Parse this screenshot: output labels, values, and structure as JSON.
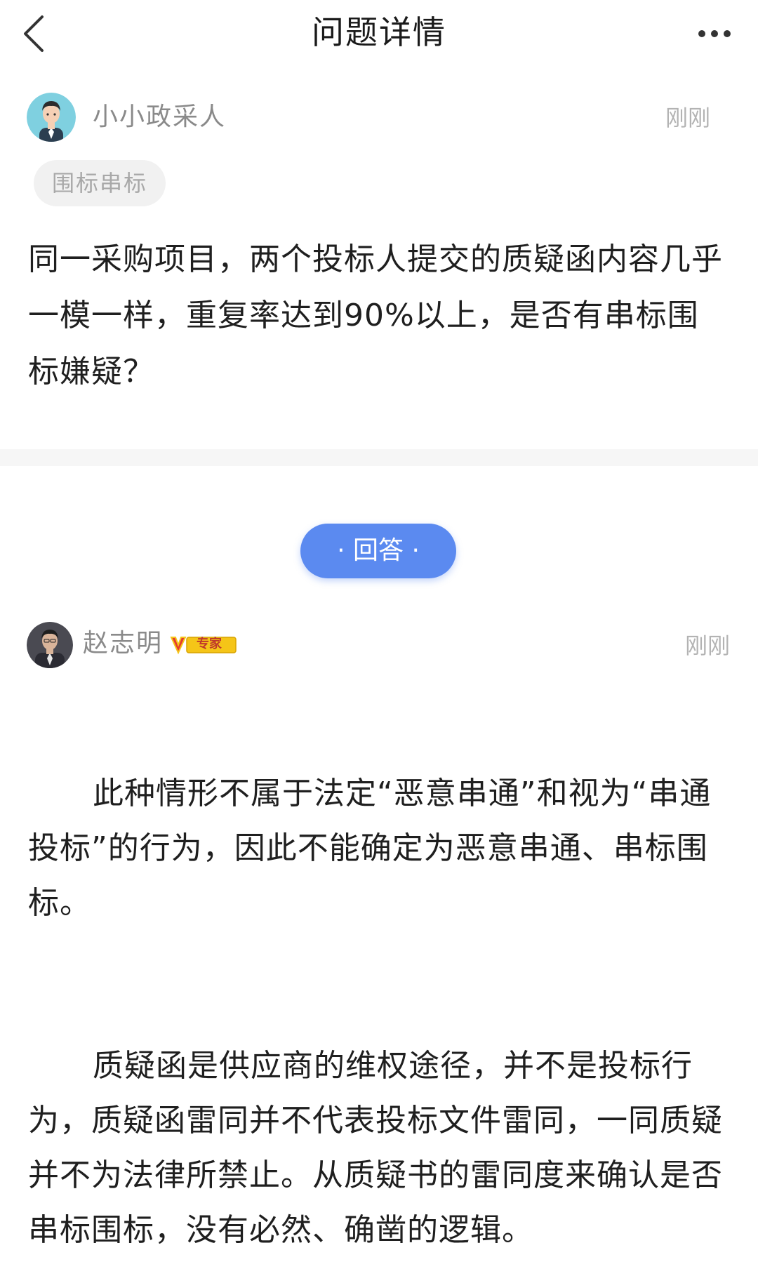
{
  "header": {
    "title": "问题详情",
    "back_icon": "chevron-left-icon",
    "more_icon": "more-horizontal-icon"
  },
  "question": {
    "author": "小小政采人",
    "time": "刚刚",
    "tag": "围标串标",
    "text": "同一采购项目，两个投标人提交的质疑函内容几乎一模一样，重复率达到90%以上，是否有串标围标嫌疑？"
  },
  "answer_button": {
    "label": "· 回答 ·"
  },
  "answer": {
    "author": "赵志明",
    "badge": "专家",
    "time": "刚刚",
    "paragraphs": [
      "此种情形不属于法定“恶意串通”和视为“串通投标”的行为，因此不能确定为恶意串通、串标围标。",
      "质疑函是供应商的维权途径，并不是投标行为，质疑函雷同并不代表投标文件雷同，一同质疑并不为法律所禁止。从质疑书的雷同度来确认是否串标围标，没有必然、确凿的逻辑。"
    ]
  },
  "colors": {
    "accent": "#5b8af0",
    "muted_text": "#8a8a8a",
    "time_text": "#b3b3b3",
    "badge_gold": "#f5c518"
  }
}
